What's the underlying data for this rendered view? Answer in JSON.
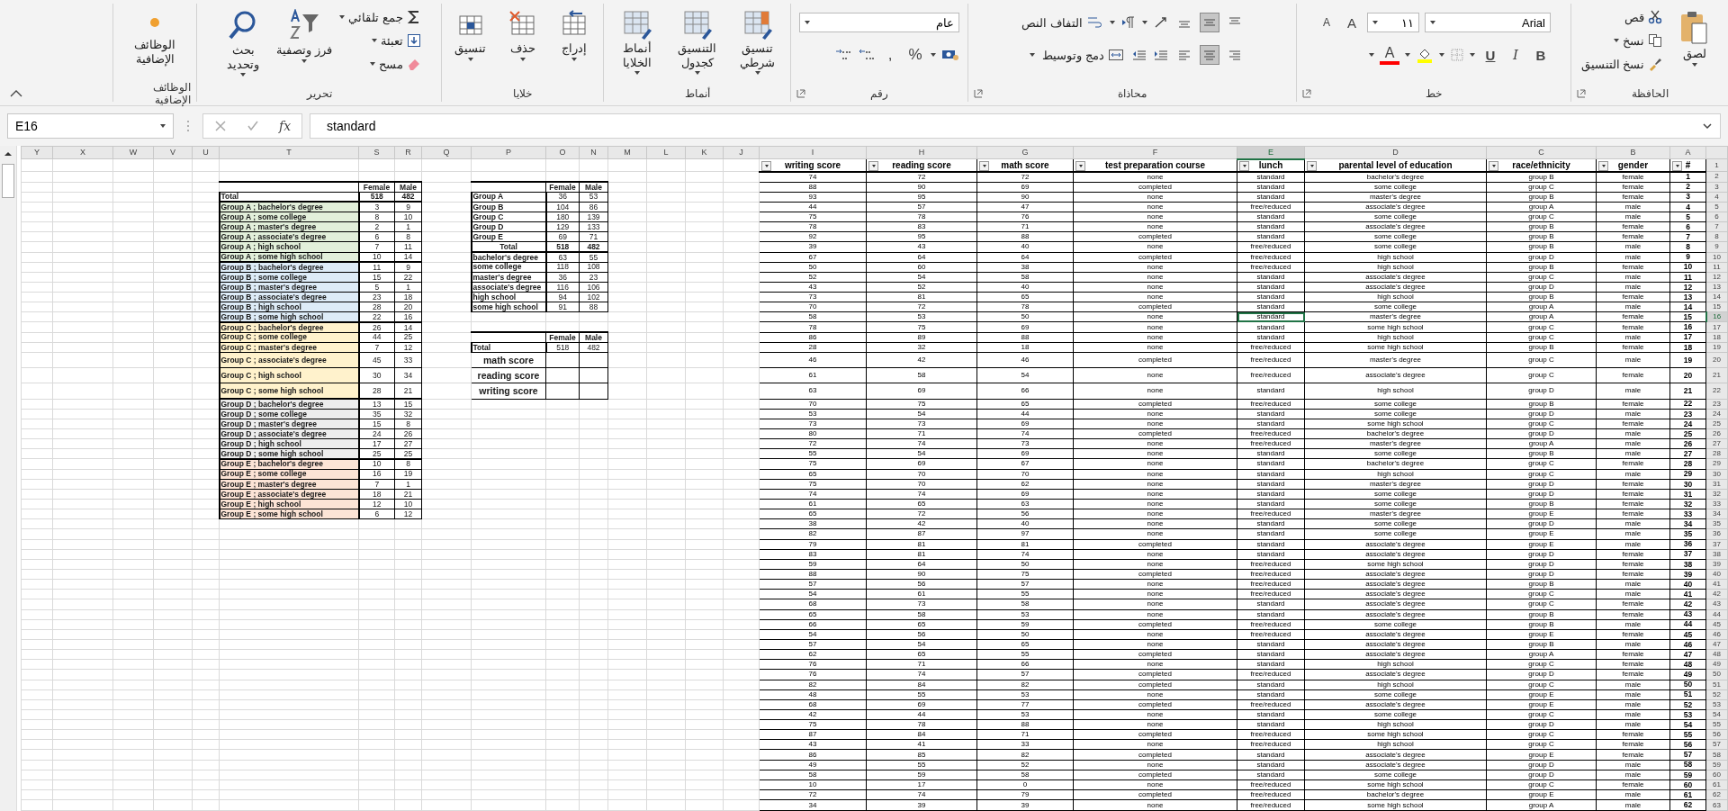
{
  "ribbon": {
    "groups": [
      {
        "kind": "clipboard",
        "label": "الحافظة",
        "paste": "لصق",
        "cut": "قص",
        "copy": "نسخ",
        "format_painter": "نسخ التنسيق"
      },
      {
        "kind": "font",
        "label": "خط",
        "font_name": "Arial",
        "font_size": "١١",
        "grow": "A",
        "shrink": "A",
        "bold": "B",
        "italic": "I",
        "underline": "U",
        "font_color": "A"
      },
      {
        "kind": "alignment",
        "label": "محاذاة",
        "wrap_text": "التفاف النص",
        "merge_center": "دمج وتوسيط",
        "vertical": [
          {
            "selected": false
          },
          {
            "selected": true
          },
          {
            "selected": false
          }
        ],
        "horizontal": [
          {
            "selected": false
          },
          {
            "selected": true
          },
          {
            "selected": false
          }
        ]
      },
      {
        "kind": "number",
        "label": "رقم",
        "format": "عام",
        "percent": "%",
        "comma": ","
      },
      {
        "kind": "styles",
        "label": "أنماط",
        "buttons": [
          "تنسيق شرطي",
          "التنسيق كجدول",
          "أنماط الخلايا"
        ]
      },
      {
        "kind": "cells",
        "label": "خلايا",
        "buttons": [
          "إدراج",
          "حذف",
          "تنسيق"
        ]
      },
      {
        "kind": "editing",
        "label": "تحرير",
        "autosum": "جمع تلقائي",
        "fill": "تعبئة",
        "clear": "مسح",
        "sort": "فرز وتصفية",
        "find": "بحث وتحديد"
      },
      {
        "kind": "addins",
        "label": "الوظائف الإضافية",
        "button": "الوظائف الإضافية"
      }
    ]
  },
  "name_box": "E16",
  "function_label": "fx",
  "formula": "standard",
  "column_headers": [
    {
      "label": "Y",
      "selected": false
    },
    {
      "label": "X",
      "selected": false
    },
    {
      "label": "W",
      "selected": false
    },
    {
      "label": "V",
      "selected": false
    },
    {
      "label": "U",
      "selected": false
    },
    {
      "label": "T",
      "selected": false
    },
    {
      "label": "S",
      "selected": false
    },
    {
      "label": "R",
      "selected": false
    },
    {
      "label": "Q",
      "selected": false
    },
    {
      "label": "P",
      "selected": false
    },
    {
      "label": "O",
      "selected": false
    },
    {
      "label": "N",
      "selected": false
    },
    {
      "label": "M",
      "selected": false
    },
    {
      "label": "L",
      "selected": false
    },
    {
      "label": "K",
      "selected": false
    },
    {
      "label": "J",
      "selected": false
    },
    {
      "label": "I",
      "selected": false
    },
    {
      "label": "H",
      "selected": false
    },
    {
      "label": "G",
      "selected": false
    },
    {
      "label": "F",
      "selected": false
    },
    {
      "label": "E",
      "selected": true
    },
    {
      "label": "D",
      "selected": false
    },
    {
      "label": "C",
      "selected": false
    },
    {
      "label": "B",
      "selected": false
    },
    {
      "label": "A",
      "selected": false
    }
  ],
  "row_headers": [
    {
      "label": "1",
      "selected": false
    },
    {
      "label": "2",
      "selected": false
    },
    {
      "label": "3",
      "selected": false
    },
    {
      "label": "4",
      "selected": false
    },
    {
      "label": "5",
      "selected": false
    },
    {
      "label": "6",
      "selected": false
    },
    {
      "label": "7",
      "selected": false
    },
    {
      "label": "8",
      "selected": false
    },
    {
      "label": "9",
      "selected": false
    },
    {
      "label": "10",
      "selected": false
    },
    {
      "label": "11",
      "selected": false
    },
    {
      "label": "12",
      "selected": false
    },
    {
      "label": "13",
      "selected": false
    },
    {
      "label": "14",
      "selected": false
    },
    {
      "label": "15",
      "selected": false
    },
    {
      "label": "16",
      "selected": true
    },
    {
      "label": "17",
      "selected": false
    },
    {
      "label": "18",
      "selected": false
    },
    {
      "label": "19",
      "selected": false
    },
    {
      "label": "20",
      "selected": false
    },
    {
      "label": "21",
      "selected": false
    },
    {
      "label": "22",
      "selected": false
    },
    {
      "label": "23",
      "selected": false
    },
    {
      "label": "24",
      "selected": false
    },
    {
      "label": "25",
      "selected": false
    },
    {
      "label": "26",
      "selected": false
    },
    {
      "label": "27",
      "selected": false
    },
    {
      "label": "28",
      "selected": false
    },
    {
      "label": "29",
      "selected": false
    },
    {
      "label": "30",
      "selected": false
    },
    {
      "label": "31",
      "selected": false
    },
    {
      "label": "32",
      "selected": false
    },
    {
      "label": "33",
      "selected": false
    },
    {
      "label": "34",
      "selected": false
    },
    {
      "label": "35",
      "selected": false
    },
    {
      "label": "36",
      "selected": false
    },
    {
      "label": "37",
      "selected": false
    },
    {
      "label": "38",
      "selected": false
    },
    {
      "label": "39",
      "selected": false
    },
    {
      "label": "40",
      "selected": false
    },
    {
      "label": "41",
      "selected": false
    },
    {
      "label": "42",
      "selected": false
    },
    {
      "label": "43",
      "selected": false
    },
    {
      "label": "44",
      "selected": false
    },
    {
      "label": "45",
      "selected": false
    },
    {
      "label": "46",
      "selected": false
    },
    {
      "label": "47",
      "selected": false
    },
    {
      "label": "48",
      "selected": false
    },
    {
      "label": "49",
      "selected": false
    },
    {
      "label": "50",
      "selected": false
    },
    {
      "label": "51",
      "selected": false
    },
    {
      "label": "52",
      "selected": false
    },
    {
      "label": "53",
      "selected": false
    },
    {
      "label": "54",
      "selected": false
    },
    {
      "label": "55",
      "selected": false
    },
    {
      "label": "56",
      "selected": false
    },
    {
      "label": "57",
      "selected": false
    },
    {
      "label": "58",
      "selected": false
    },
    {
      "label": "59",
      "selected": false
    },
    {
      "label": "60",
      "selected": false
    },
    {
      "label": "61",
      "selected": false
    },
    {
      "label": "62",
      "selected": false
    },
    {
      "label": "63",
      "selected": false
    }
  ],
  "data_table": {
    "columns": [
      {
        "label": "writing score"
      },
      {
        "label": "reading score"
      },
      {
        "label": "math score"
      },
      {
        "label": "test preparation course"
      },
      {
        "label": "lunch"
      },
      {
        "label": "parental level of education"
      },
      {
        "label": "race/ethnicity"
      },
      {
        "label": "gender"
      },
      {
        "label": "#"
      }
    ],
    "rows": [
      {
        "cells": [
          "74",
          "72",
          "72",
          "none",
          "standard",
          "bachelor's degree",
          "group B",
          "female",
          "1"
        ]
      },
      {
        "cells": [
          "88",
          "90",
          "69",
          "completed",
          "standard",
          "some college",
          "group C",
          "female",
          "2"
        ]
      },
      {
        "cells": [
          "93",
          "95",
          "90",
          "none",
          "standard",
          "master's degree",
          "group B",
          "female",
          "3"
        ]
      },
      {
        "cells": [
          "44",
          "57",
          "47",
          "none",
          "free/reduced",
          "associate's degree",
          "group A",
          "male",
          "4"
        ]
      },
      {
        "cells": [
          "75",
          "78",
          "76",
          "none",
          "standard",
          "some college",
          "group C",
          "male",
          "5"
        ]
      },
      {
        "cells": [
          "78",
          "83",
          "71",
          "none",
          "standard",
          "associate's degree",
          "group B",
          "female",
          "6"
        ]
      },
      {
        "cells": [
          "92",
          "95",
          "88",
          "completed",
          "standard",
          "some college",
          "group B",
          "female",
          "7"
        ]
      },
      {
        "cells": [
          "39",
          "43",
          "40",
          "none",
          "free/reduced",
          "some college",
          "group B",
          "male",
          "8"
        ]
      },
      {
        "cells": [
          "67",
          "64",
          "64",
          "completed",
          "free/reduced",
          "high school",
          "group D",
          "male",
          "9"
        ]
      },
      {
        "cells": [
          "50",
          "60",
          "38",
          "none",
          "free/reduced",
          "high school",
          "group B",
          "female",
          "10"
        ]
      },
      {
        "cells": [
          "52",
          "54",
          "58",
          "none",
          "standard",
          "associate's degree",
          "group C",
          "male",
          "11"
        ]
      },
      {
        "cells": [
          "43",
          "52",
          "40",
          "none",
          "standard",
          "associate's degree",
          "group D",
          "male",
          "12"
        ]
      },
      {
        "cells": [
          "73",
          "81",
          "65",
          "none",
          "standard",
          "high school",
          "group B",
          "female",
          "13"
        ]
      },
      {
        "cells": [
          "70",
          "72",
          "78",
          "completed",
          "standard",
          "some college",
          "group A",
          "male",
          "14"
        ]
      },
      {
        "cells": [
          "58",
          "53",
          "50",
          "none",
          "standard",
          "master's degree",
          "group A",
          "female",
          "15"
        ]
      },
      {
        "cells": [
          "78",
          "75",
          "69",
          "none",
          "standard",
          "some high school",
          "group C",
          "female",
          "16"
        ]
      },
      {
        "cells": [
          "86",
          "89",
          "88",
          "none",
          "standard",
          "high school",
          "group C",
          "male",
          "17"
        ]
      },
      {
        "cells": [
          "28",
          "32",
          "18",
          "none",
          "free/reduced",
          "some high school",
          "group B",
          "female",
          "18"
        ]
      },
      {
        "cells": [
          "46",
          "42",
          "46",
          "completed",
          "free/reduced",
          "master's degree",
          "group C",
          "male",
          "19"
        ]
      },
      {
        "cells": [
          "61",
          "58",
          "54",
          "none",
          "free/reduced",
          "associate's degree",
          "group C",
          "female",
          "20"
        ]
      },
      {
        "cells": [
          "63",
          "69",
          "66",
          "none",
          "standard",
          "high school",
          "group D",
          "male",
          "21"
        ]
      },
      {
        "cells": [
          "70",
          "75",
          "65",
          "completed",
          "free/reduced",
          "some college",
          "group B",
          "female",
          "22"
        ]
      },
      {
        "cells": [
          "53",
          "54",
          "44",
          "none",
          "standard",
          "some college",
          "group D",
          "male",
          "23"
        ]
      },
      {
        "cells": [
          "73",
          "73",
          "69",
          "none",
          "standard",
          "some high school",
          "group C",
          "female",
          "24"
        ]
      },
      {
        "cells": [
          "80",
          "71",
          "74",
          "completed",
          "free/reduced",
          "bachelor's degree",
          "group D",
          "male",
          "25"
        ]
      },
      {
        "cells": [
          "72",
          "74",
          "73",
          "none",
          "free/reduced",
          "master's degree",
          "group A",
          "male",
          "26"
        ]
      },
      {
        "cells": [
          "55",
          "54",
          "69",
          "none",
          "standard",
          "some college",
          "group B",
          "male",
          "27"
        ]
      },
      {
        "cells": [
          "75",
          "69",
          "67",
          "none",
          "standard",
          "bachelor's degree",
          "group C",
          "female",
          "28"
        ]
      },
      {
        "cells": [
          "65",
          "70",
          "70",
          "none",
          "standard",
          "high school",
          "group C",
          "male",
          "29"
        ]
      },
      {
        "cells": [
          "75",
          "70",
          "62",
          "none",
          "standard",
          "master's degree",
          "group D",
          "female",
          "30"
        ]
      },
      {
        "cells": [
          "74",
          "74",
          "69",
          "none",
          "standard",
          "some college",
          "group D",
          "female",
          "31"
        ]
      },
      {
        "cells": [
          "61",
          "65",
          "63",
          "none",
          "standard",
          "some college",
          "group B",
          "female",
          "32"
        ]
      },
      {
        "cells": [
          "65",
          "72",
          "56",
          "none",
          "free/reduced",
          "master's degree",
          "group E",
          "female",
          "33"
        ]
      },
      {
        "cells": [
          "38",
          "42",
          "40",
          "none",
          "standard",
          "some college",
          "group D",
          "male",
          "34"
        ]
      },
      {
        "cells": [
          "82",
          "87",
          "97",
          "none",
          "standard",
          "some college",
          "group E",
          "male",
          "35"
        ]
      },
      {
        "cells": [
          "79",
          "81",
          "81",
          "completed",
          "standard",
          "associate's degree",
          "group E",
          "male",
          "36"
        ]
      },
      {
        "cells": [
          "83",
          "81",
          "74",
          "none",
          "standard",
          "associate's degree",
          "group D",
          "female",
          "37"
        ]
      },
      {
        "cells": [
          "59",
          "64",
          "50",
          "none",
          "free/reduced",
          "some high school",
          "group D",
          "female",
          "38"
        ]
      },
      {
        "cells": [
          "88",
          "90",
          "75",
          "completed",
          "free/reduced",
          "associate's degree",
          "group D",
          "female",
          "39"
        ]
      },
      {
        "cells": [
          "57",
          "56",
          "57",
          "none",
          "free/reduced",
          "associate's degree",
          "group B",
          "male",
          "40"
        ]
      },
      {
        "cells": [
          "54",
          "61",
          "55",
          "none",
          "free/reduced",
          "associate's degree",
          "group C",
          "male",
          "41"
        ]
      },
      {
        "cells": [
          "68",
          "73",
          "58",
          "none",
          "standard",
          "associate's degree",
          "group C",
          "female",
          "42"
        ]
      },
      {
        "cells": [
          "65",
          "58",
          "53",
          "none",
          "standard",
          "associate's degree",
          "group B",
          "female",
          "43"
        ]
      },
      {
        "cells": [
          "66",
          "65",
          "59",
          "completed",
          "free/reduced",
          "some college",
          "group B",
          "male",
          "44"
        ]
      },
      {
        "cells": [
          "54",
          "56",
          "50",
          "none",
          "free/reduced",
          "associate's degree",
          "group E",
          "female",
          "45"
        ]
      },
      {
        "cells": [
          "57",
          "54",
          "65",
          "none",
          "standard",
          "associate's degree",
          "group B",
          "male",
          "46"
        ]
      },
      {
        "cells": [
          "62",
          "65",
          "55",
          "completed",
          "standard",
          "associate's degree",
          "group A",
          "female",
          "47"
        ]
      },
      {
        "cells": [
          "76",
          "71",
          "66",
          "none",
          "standard",
          "high school",
          "group C",
          "female",
          "48"
        ]
      },
      {
        "cells": [
          "76",
          "74",
          "57",
          "completed",
          "free/reduced",
          "associate's degree",
          "group D",
          "female",
          "49"
        ]
      },
      {
        "cells": [
          "82",
          "84",
          "82",
          "completed",
          "standard",
          "high school",
          "group C",
          "male",
          "50"
        ]
      },
      {
        "cells": [
          "48",
          "55",
          "53",
          "none",
          "standard",
          "some college",
          "group E",
          "male",
          "51"
        ]
      },
      {
        "cells": [
          "68",
          "69",
          "77",
          "completed",
          "free/reduced",
          "associate's degree",
          "group E",
          "male",
          "52"
        ]
      },
      {
        "cells": [
          "42",
          "44",
          "53",
          "none",
          "standard",
          "some college",
          "group C",
          "male",
          "53"
        ]
      },
      {
        "cells": [
          "75",
          "78",
          "88",
          "none",
          "standard",
          "high school",
          "group D",
          "male",
          "54"
        ]
      },
      {
        "cells": [
          "87",
          "84",
          "71",
          "completed",
          "free/reduced",
          "some high school",
          "group C",
          "female",
          "55"
        ]
      },
      {
        "cells": [
          "43",
          "41",
          "33",
          "none",
          "free/reduced",
          "high school",
          "group C",
          "female",
          "56"
        ]
      },
      {
        "cells": [
          "86",
          "85",
          "82",
          "completed",
          "standard",
          "associate's degree",
          "group E",
          "female",
          "57"
        ]
      },
      {
        "cells": [
          "49",
          "55",
          "52",
          "none",
          "standard",
          "associate's degree",
          "group D",
          "male",
          "58"
        ]
      },
      {
        "cells": [
          "58",
          "59",
          "58",
          "completed",
          "standard",
          "some college",
          "group D",
          "male",
          "59"
        ]
      },
      {
        "cells": [
          "10",
          "17",
          "0",
          "none",
          "free/reduced",
          "some high school",
          "group C",
          "female",
          "60"
        ]
      },
      {
        "cells": [
          "72",
          "74",
          "79",
          "completed",
          "free/reduced",
          "bachelor's degree",
          "group E",
          "male",
          "61"
        ]
      },
      {
        "cells": [
          "34",
          "39",
          "39",
          "none",
          "free/reduced",
          "some high school",
          "group A",
          "male",
          "62"
        ]
      }
    ]
  },
  "group_education_table": {
    "columns": [
      "Female",
      "Male"
    ],
    "total": {
      "label": "Total",
      "female": "518",
      "male": "482"
    },
    "rows": [
      {
        "label": "Group A ; bachelor's degree",
        "female": "3",
        "male": "9",
        "color": "#e2efda"
      },
      {
        "label": "Group A ; some college",
        "female": "8",
        "male": "10",
        "color": "#e2efda"
      },
      {
        "label": "Group A ; master's degree",
        "female": "2",
        "male": "1",
        "color": "#e2efda"
      },
      {
        "label": "Group A ; associate's degree",
        "female": "6",
        "male": "8",
        "color": "#e2efda"
      },
      {
        "label": "Group A ; high school",
        "female": "7",
        "male": "11",
        "color": "#e2efda"
      },
      {
        "label": "Group A ; some high school",
        "female": "10",
        "male": "14",
        "color": "#e2efda"
      },
      {
        "label": "Group B ; bachelor's degree",
        "female": "11",
        "male": "9",
        "color": "#ddebf7"
      },
      {
        "label": "Group B ; some college",
        "female": "15",
        "male": "22",
        "color": "#ddebf7"
      },
      {
        "label": "Group B ; master's degree",
        "female": "5",
        "male": "1",
        "color": "#ddebf7"
      },
      {
        "label": "Group B ; associate's degree",
        "female": "23",
        "male": "18",
        "color": "#ddebf7"
      },
      {
        "label": "Group B ; high school",
        "female": "28",
        "male": "20",
        "color": "#ddebf7"
      },
      {
        "label": "Group B ; some high school",
        "female": "22",
        "male": "16",
        "color": "#ddebf7"
      },
      {
        "label": "Group C ; bachelor's degree",
        "female": "26",
        "male": "14",
        "color": "#fff2cc"
      },
      {
        "label": "Group C ; some college",
        "female": "44",
        "male": "25",
        "color": "#fff2cc"
      },
      {
        "label": "Group C ; master's degree",
        "female": "7",
        "male": "12",
        "color": "#fff2cc"
      },
      {
        "label": "Group C ; associate's degree",
        "female": "45",
        "male": "33",
        "color": "#fff2cc"
      },
      {
        "label": "Group C ; high school",
        "female": "30",
        "male": "34",
        "color": "#fff2cc"
      },
      {
        "label": "Group C ; some high school",
        "female": "28",
        "male": "21",
        "color": "#fff2cc"
      },
      {
        "label": "Group D ; bachelor's degree",
        "female": "13",
        "male": "15",
        "color": "#ededed"
      },
      {
        "label": "Group D ; some college",
        "female": "35",
        "male": "32",
        "color": "#ededed"
      },
      {
        "label": "Group D ; master's degree",
        "female": "15",
        "male": "8",
        "color": "#ededed"
      },
      {
        "label": "Group D ; associate's degree",
        "female": "24",
        "male": "26",
        "color": "#ededed"
      },
      {
        "label": "Group D ; high school",
        "female": "17",
        "male": "27",
        "color": "#ededed"
      },
      {
        "label": "Group D ; some high school",
        "female": "25",
        "male": "25",
        "color": "#ededed"
      },
      {
        "label": "Group E ; bachelor's degree",
        "female": "10",
        "male": "8",
        "color": "#fce4d6"
      },
      {
        "label": "Group E ; some college",
        "female": "16",
        "male": "19",
        "color": "#fce4d6"
      },
      {
        "label": "Group E ; master's degree",
        "female": "7",
        "male": "1",
        "color": "#fce4d6"
      },
      {
        "label": "Group E ; associate's degree",
        "female": "18",
        "male": "21",
        "color": "#fce4d6"
      },
      {
        "label": "Group E ; high school",
        "female": "12",
        "male": "10",
        "color": "#fce4d6"
      },
      {
        "label": "Group E ; some high school",
        "female": "6",
        "male": "12",
        "color": "#fce4d6"
      }
    ]
  },
  "group_table": {
    "columns": [
      "Female",
      "Male"
    ],
    "rows": [
      {
        "label": "Group A",
        "female": "36",
        "male": "53"
      },
      {
        "label": "Group B",
        "female": "104",
        "male": "86"
      },
      {
        "label": "Group C",
        "female": "180",
        "male": "139"
      },
      {
        "label": "Group D",
        "female": "129",
        "male": "133"
      },
      {
        "label": "Group E",
        "female": "69",
        "male": "71"
      }
    ],
    "total": {
      "label": "Total",
      "female": "518",
      "male": "482"
    },
    "education_rows": [
      {
        "label": "bachelor's degree",
        "female": "63",
        "male": "55"
      },
      {
        "label": "some college",
        "female": "118",
        "male": "108"
      },
      {
        "label": "master's degree",
        "female": "36",
        "male": "23"
      },
      {
        "label": "associate's degree",
        "female": "116",
        "male": "106"
      },
      {
        "label": "high school",
        "female": "94",
        "male": "102"
      },
      {
        "label": "some high school",
        "female": "91",
        "male": "88"
      }
    ]
  },
  "score_table": {
    "columns": [
      "Female",
      "Male"
    ],
    "total": {
      "label": "Total",
      "female": "518",
      "male": "482"
    },
    "rows": [
      {
        "label": "math score"
      },
      {
        "label": "reading score"
      },
      {
        "label": "writing score"
      }
    ]
  }
}
